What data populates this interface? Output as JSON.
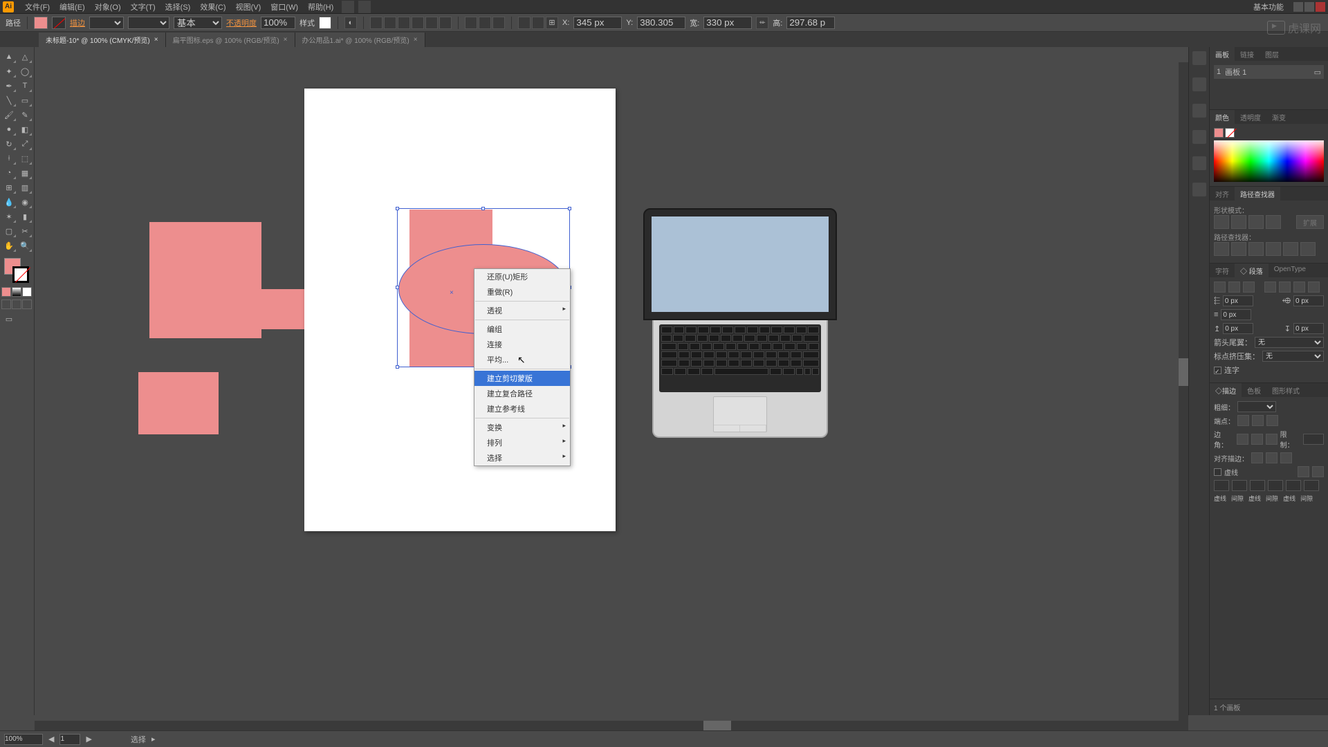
{
  "app_icon": "Ai",
  "menus": [
    "文件(F)",
    "编辑(E)",
    "对象(O)",
    "文字(T)",
    "选择(S)",
    "效果(C)",
    "视图(V)",
    "窗口(W)",
    "帮助(H)"
  ],
  "titlebar_right_label": "基本功能",
  "control": {
    "label": "路径",
    "stroke_link": "描边",
    "stroke_preset": "基本",
    "opacity_label": "不透明度",
    "opacity_value": "100%",
    "style_label": "样式",
    "x_label": "X:",
    "x_value": "345 px",
    "y_label": "Y:",
    "y_value": "380.305",
    "w_label": "宽:",
    "w_value": "330 px",
    "h_label": "高:",
    "h_value": "297.68 p"
  },
  "doc_tabs": [
    {
      "label": "未标题-10* @ 100% (CMYK/预览)",
      "active": true
    },
    {
      "label": "扁平图标.eps @ 100% (RGB/预览)",
      "active": false
    },
    {
      "label": "办公用品1.ai* @ 100% (RGB/预览)",
      "active": false
    }
  ],
  "context_menu": {
    "items": [
      {
        "label": "还原(U)矩形",
        "type": "item"
      },
      {
        "label": "重做(R)",
        "type": "item"
      },
      {
        "type": "sep"
      },
      {
        "label": "透视",
        "type": "sub"
      },
      {
        "type": "sep"
      },
      {
        "label": "编组",
        "type": "item"
      },
      {
        "label": "连接",
        "type": "item"
      },
      {
        "label": "平均...",
        "type": "item"
      },
      {
        "type": "sep"
      },
      {
        "label": "建立剪切蒙版",
        "type": "item",
        "highlight": true
      },
      {
        "label": "建立复合路径",
        "type": "item"
      },
      {
        "label": "建立参考线",
        "type": "item"
      },
      {
        "type": "sep"
      },
      {
        "label": "变换",
        "type": "sub"
      },
      {
        "label": "排列",
        "type": "sub"
      },
      {
        "label": "选择",
        "type": "sub"
      }
    ]
  },
  "panels": {
    "artboard": {
      "tabs": [
        "画板",
        "链接",
        "图层"
      ],
      "active": 0,
      "item_index": "1",
      "item_name": "画板 1"
    },
    "color": {
      "tabs": [
        "颜色",
        "透明度",
        "渐变"
      ],
      "active": 0
    },
    "pathfinder": {
      "tabs": [
        "对齐",
        "路径查找器"
      ],
      "active": 1,
      "shape_mode": "形状模式：",
      "pf_label": "路径查找器：",
      "expand": "扩展"
    },
    "character": {
      "tabs": [
        "字符",
        "◇ 段落",
        "OpenType"
      ],
      "active": 1,
      "val_0": "0 px",
      "arrow_opt": "无",
      "arrow_label": "箭头尾翼：",
      "punct_label": "标点挤压集：",
      "hyphen": "连字"
    },
    "stroke": {
      "tabs": [
        "◇描边",
        "色板",
        "图形样式"
      ],
      "active": 0,
      "weight_label": "粗细：",
      "cap_label": "端点：",
      "corner_label": "边角：",
      "limit_label": "限制：",
      "align_label": "对齐描边：",
      "dash_label": "虚线",
      "dash_cols": [
        "虚线",
        "间隙",
        "虚线",
        "间隙",
        "虚线",
        "间隙"
      ]
    }
  },
  "status": {
    "zoom": "100%",
    "nav": "1",
    "tool": "选择",
    "artboards": "1 个画板"
  },
  "watermark": "虎课网"
}
